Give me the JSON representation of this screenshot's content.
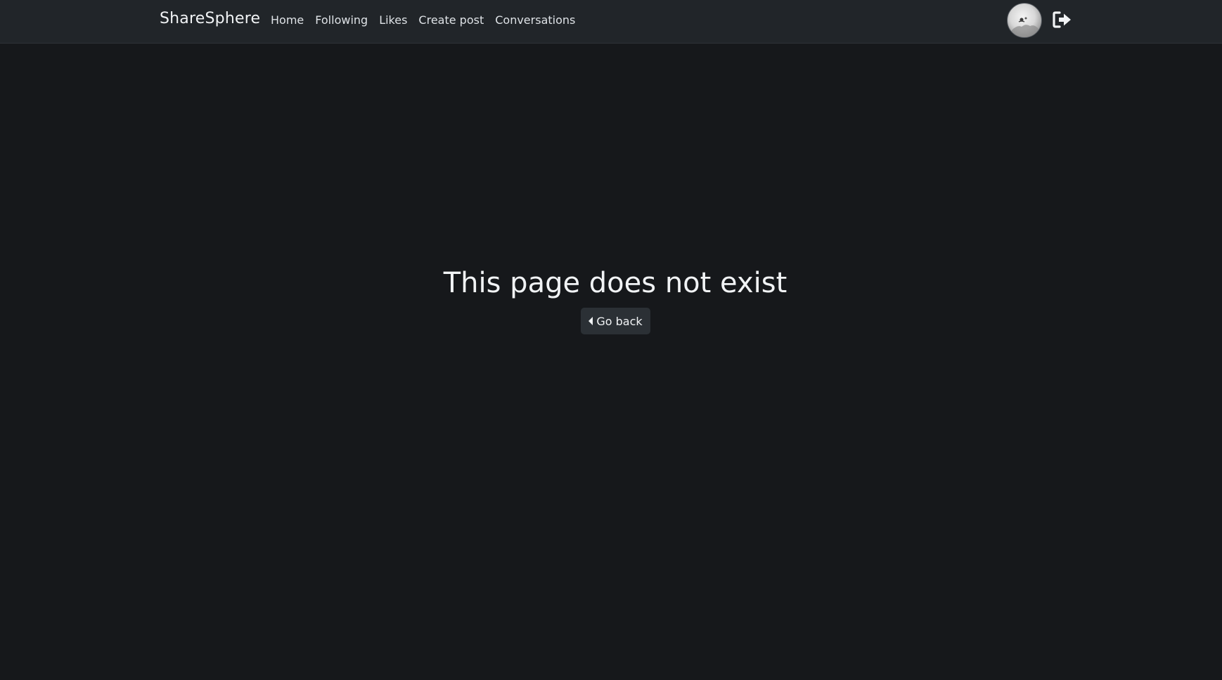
{
  "navbar": {
    "brand": "ShareSphere",
    "links": [
      "Home",
      "Following",
      "Likes",
      "Create post",
      "Conversations"
    ],
    "avatar_icon": "user-avatar",
    "logout_icon": "sign-out-icon"
  },
  "main": {
    "title": "This page does not exist",
    "back_button_label": "Go back"
  },
  "colors": {
    "background": "#16181b",
    "navbar": "#212529",
    "button": "#2b3035"
  }
}
